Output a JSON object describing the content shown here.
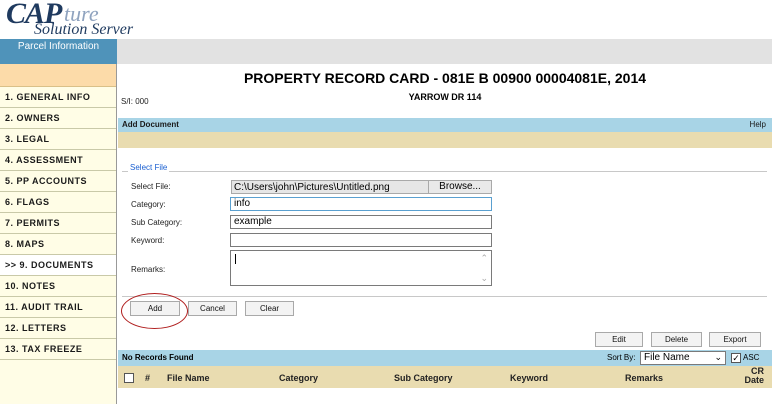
{
  "logo": {
    "cap": "CAP",
    "ture": "ture",
    "solution": "Solution Server"
  },
  "tabs": {
    "parcel": "Parcel Information"
  },
  "sidebar": {
    "items": [
      {
        "label": "1. GENERAL INFO"
      },
      {
        "label": "2. OWNERS"
      },
      {
        "label": "3. LEGAL"
      },
      {
        "label": "4. ASSESSMENT"
      },
      {
        "label": "5. PP ACCOUNTS"
      },
      {
        "label": "6. FLAGS"
      },
      {
        "label": "7. PERMITS"
      },
      {
        "label": "8. MAPS"
      },
      {
        "label": ">> 9. DOCUMENTS"
      },
      {
        "label": "10. NOTES"
      },
      {
        "label": "11. AUDIT TRAIL"
      },
      {
        "label": "12. LETTERS"
      },
      {
        "label": "13. TAX FREEZE"
      }
    ]
  },
  "header": {
    "title": "PROPERTY RECORD CARD - 081E B 00900 00004081E, 2014",
    "address": "YARROW DR 114",
    "sf": "S/I: 000"
  },
  "panel": {
    "title": "Add Document",
    "help": "Help"
  },
  "form": {
    "legend": "Select File",
    "select_file_label": "Select File:",
    "file_path": "C:\\Users\\john\\Pictures\\Untitled.png",
    "browse": "Browse...",
    "category_label": "Category:",
    "category_value": "info",
    "subcategory_label": "Sub Category:",
    "subcategory_value": "example",
    "keyword_label": "Keyword:",
    "keyword_value": "",
    "remarks_label": "Remarks:",
    "remarks_value": ""
  },
  "buttons": {
    "add": "Add",
    "cancel": "Cancel",
    "clear": "Clear",
    "edit": "Edit",
    "delete": "Delete",
    "export": "Export"
  },
  "list": {
    "status": "No Records Found",
    "sort_by_label": "Sort By:",
    "sort_by_value": "File Name",
    "asc_label": "ASC",
    "asc_checked": true,
    "columns": [
      "#",
      "File Name",
      "Category",
      "Sub Category",
      "Keyword",
      "Remarks",
      "CR Date"
    ]
  }
}
